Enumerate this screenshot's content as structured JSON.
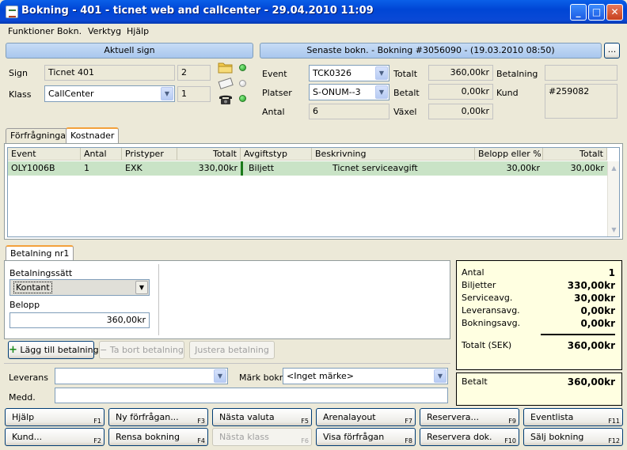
{
  "window": {
    "title": "Bokning - 401 - ticnet web and callcenter - 29.04.2010 11:09"
  },
  "menu": [
    "Funktioner",
    "Bokn.",
    "Verktyg",
    "Hjälp"
  ],
  "current_sign": {
    "header": "Aktuell sign",
    "sign_label": "Sign",
    "sign_value": "Ticnet 401",
    "sign_num": "2",
    "class_label": "Klass",
    "class_value": "CallCenter",
    "class_num": "1"
  },
  "latest_booking": {
    "header": "Senaste bokn. - Bokning #3056090 - (19.03.2010 08:50)",
    "more_label": "...",
    "event_label": "Event",
    "event_value": "TCK0326",
    "places_label": "Platser",
    "places_value": "S-ONUM--3",
    "count_label": "Antal",
    "count_value": "6",
    "total_label": "Totalt",
    "total_value": "360,00kr",
    "paid_label": "Betalt",
    "paid_value": "0,00kr",
    "change_label": "Växel",
    "change_value": "0,00kr",
    "payment_label": "Betalning",
    "payment_value": "",
    "customer_label": "Kund",
    "customer_value": "#259082"
  },
  "tabs": [
    "Förfrågningar",
    "Kostnader"
  ],
  "costs_table": {
    "columns": [
      "Event",
      "Antal",
      "Pristyper",
      "Totalt",
      "Avgiftstyp",
      "Beskrivning",
      "Belopp eller %",
      "Totalt"
    ],
    "rows": [
      [
        "OLY1006B",
        "1",
        "EXK",
        "330,00kr",
        "Biljett",
        "Ticnet serviceavgift",
        "30,00kr",
        "30,00kr"
      ]
    ]
  },
  "payment": {
    "tab": "Betalning nr1",
    "method_label": "Betalningssätt",
    "method_value": "Kontant",
    "amount_label": "Belopp",
    "amount_value": "360,00kr",
    "add_btn": "Lägg till betalning",
    "remove_btn": "Ta bort betalning",
    "adjust_btn": "Justera betalning"
  },
  "delivery": {
    "delivery_label": "Leverans",
    "delivery_value": "",
    "mark_label": "Märk bokn",
    "mark_value": "<Inget märke>",
    "message_label": "Medd.",
    "message_value": ""
  },
  "summary": {
    "rows": [
      {
        "label": "Antal",
        "value": "1"
      },
      {
        "label": "Biljetter",
        "value": "330,00kr"
      },
      {
        "label": "Serviceavg.",
        "value": "30,00kr"
      },
      {
        "label": "Leveransavg.",
        "value": "0,00kr"
      },
      {
        "label": "Bokningsavg.",
        "value": "0,00kr"
      }
    ],
    "total_label": "Totalt (SEK)",
    "total_value": "360,00kr",
    "paid_label": "Betalt",
    "paid_value": "360,00kr",
    "bg_color": "#ffffe1"
  },
  "fkeys": {
    "row1": [
      {
        "label": "Hjälp",
        "key": "F1"
      },
      {
        "label": "Ny förfrågan...",
        "key": "F3"
      },
      {
        "label": "Nästa valuta",
        "key": "F5"
      },
      {
        "label": "Arenalayout",
        "key": "F7"
      },
      {
        "label": "Reservera...",
        "key": "F9"
      },
      {
        "label": "Eventlista",
        "key": "F11"
      }
    ],
    "row2": [
      {
        "label": "Kund...",
        "key": "F2"
      },
      {
        "label": "Rensa bokning",
        "key": "F4"
      },
      {
        "label": "Nästa klass",
        "key": "F6"
      },
      {
        "label": "Visa förfrågan",
        "key": "F8"
      },
      {
        "label": "Reservera dok.",
        "key": "F10"
      },
      {
        "label": "Sälj bokning",
        "key": "F12"
      }
    ]
  }
}
